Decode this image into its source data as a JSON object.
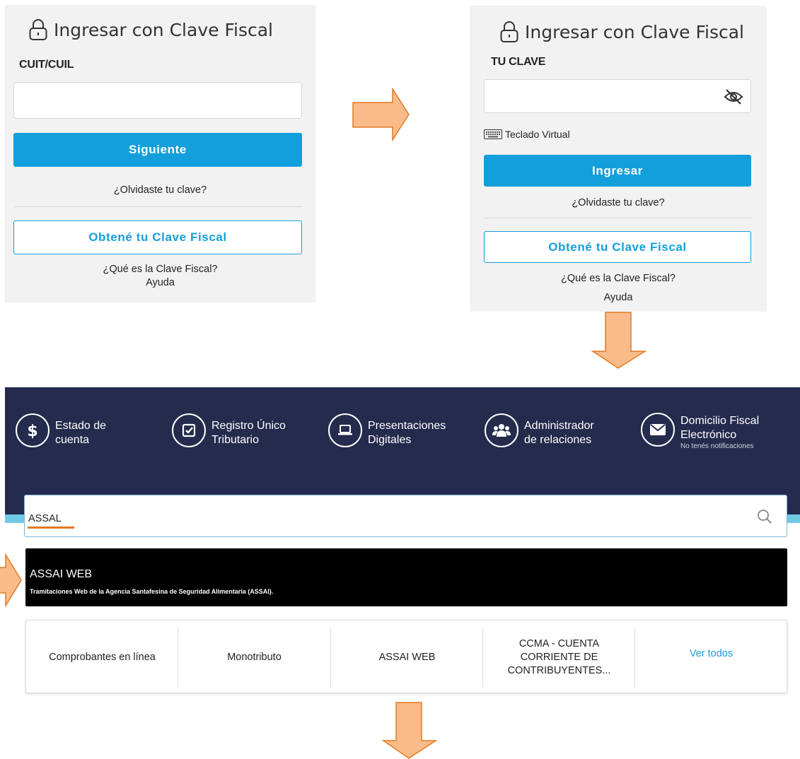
{
  "colors": {
    "accent": "#139fdb",
    "panel_bg": "#f2f2f2",
    "arrow_fill": "#f9bb89",
    "arrow_stroke": "#e07b24",
    "dash_bg": "#242b4d",
    "result_bg": "#000000"
  },
  "login_step1": {
    "title": "Ingresar con Clave Fiscal",
    "field_label": "CUIT/CUIL",
    "field_value": "",
    "next_button": "Siguiente",
    "forgot_link": "¿Olvidaste tu clave?",
    "get_key_button": "Obtené tu Clave Fiscal",
    "what_is_link": "¿Qué es la Clave Fiscal?",
    "help_link": "Ayuda"
  },
  "login_step2": {
    "title": "Ingresar con Clave Fiscal",
    "field_label": "TU CLAVE",
    "field_value": "",
    "virtual_keyboard": "Teclado Virtual",
    "login_button": "Ingresar",
    "forgot_link": "¿Olvidaste tu clave?",
    "get_key_button": "Obtené tu Clave Fiscal",
    "what_is_link": "¿Qué es la Clave Fiscal?",
    "help_link": "Ayuda"
  },
  "dashboard": {
    "items": [
      {
        "line1": "Estado de",
        "line2": "cuenta",
        "icon": "dollar-icon"
      },
      {
        "line1": "Registro Único",
        "line2": "Tributario",
        "icon": "checkbox-icon"
      },
      {
        "line1": "Presentaciones",
        "line2": "Digitales",
        "icon": "laptop-icon"
      },
      {
        "line1": "Administrador",
        "line2": "de relaciones",
        "icon": "users-icon"
      },
      {
        "line1": "Domicilio Fiscal",
        "line2": "Electrónico",
        "sub": "No tenés notificaciones",
        "icon": "envelope-icon"
      }
    ]
  },
  "search": {
    "value": "ASSAL",
    "icon": "search-icon"
  },
  "result": {
    "title": "ASSAI WEB",
    "description": "Tramitaciones Web de la Agencia Santafesina de Seguridad Alimentaria (ASSAI)."
  },
  "cards": [
    {
      "label": "Comprobantes en línea"
    },
    {
      "label": "Monotributo"
    },
    {
      "label": "ASSAI WEB"
    },
    {
      "label": "CCMA - CUENTA CORRIENTE DE CONTRIBUYENTES..."
    },
    {
      "label": "Ver todos"
    }
  ]
}
